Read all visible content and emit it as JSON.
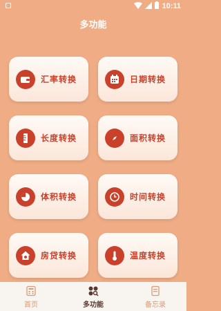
{
  "status_bar": {
    "time": "10:11"
  },
  "header": {
    "title": "多功能"
  },
  "cards": [
    {
      "label": "汇率转换",
      "icon": "wallet-icon"
    },
    {
      "label": "日期转换",
      "icon": "calendar-icon"
    },
    {
      "label": "长度转换",
      "icon": "ruler-icon"
    },
    {
      "label": "面积转换",
      "icon": "compass-icon"
    },
    {
      "label": "体积转换",
      "icon": "pie-icon"
    },
    {
      "label": "时间转换",
      "icon": "clock-icon"
    },
    {
      "label": "房贷转换",
      "icon": "house-icon"
    },
    {
      "label": "温度转换",
      "icon": "thermometer-icon"
    }
  ],
  "bottom_nav": [
    {
      "label": "首页",
      "icon": "home-calculator-icon",
      "active": false
    },
    {
      "label": "多功能",
      "icon": "multi-function-icon",
      "active": true
    },
    {
      "label": "备忘录",
      "icon": "memo-icon",
      "active": false
    }
  ],
  "colors": {
    "background": "#efac85",
    "accent": "#c9412b",
    "nav_active": "#5a3a2e",
    "nav_inactive": "#d99a76"
  }
}
